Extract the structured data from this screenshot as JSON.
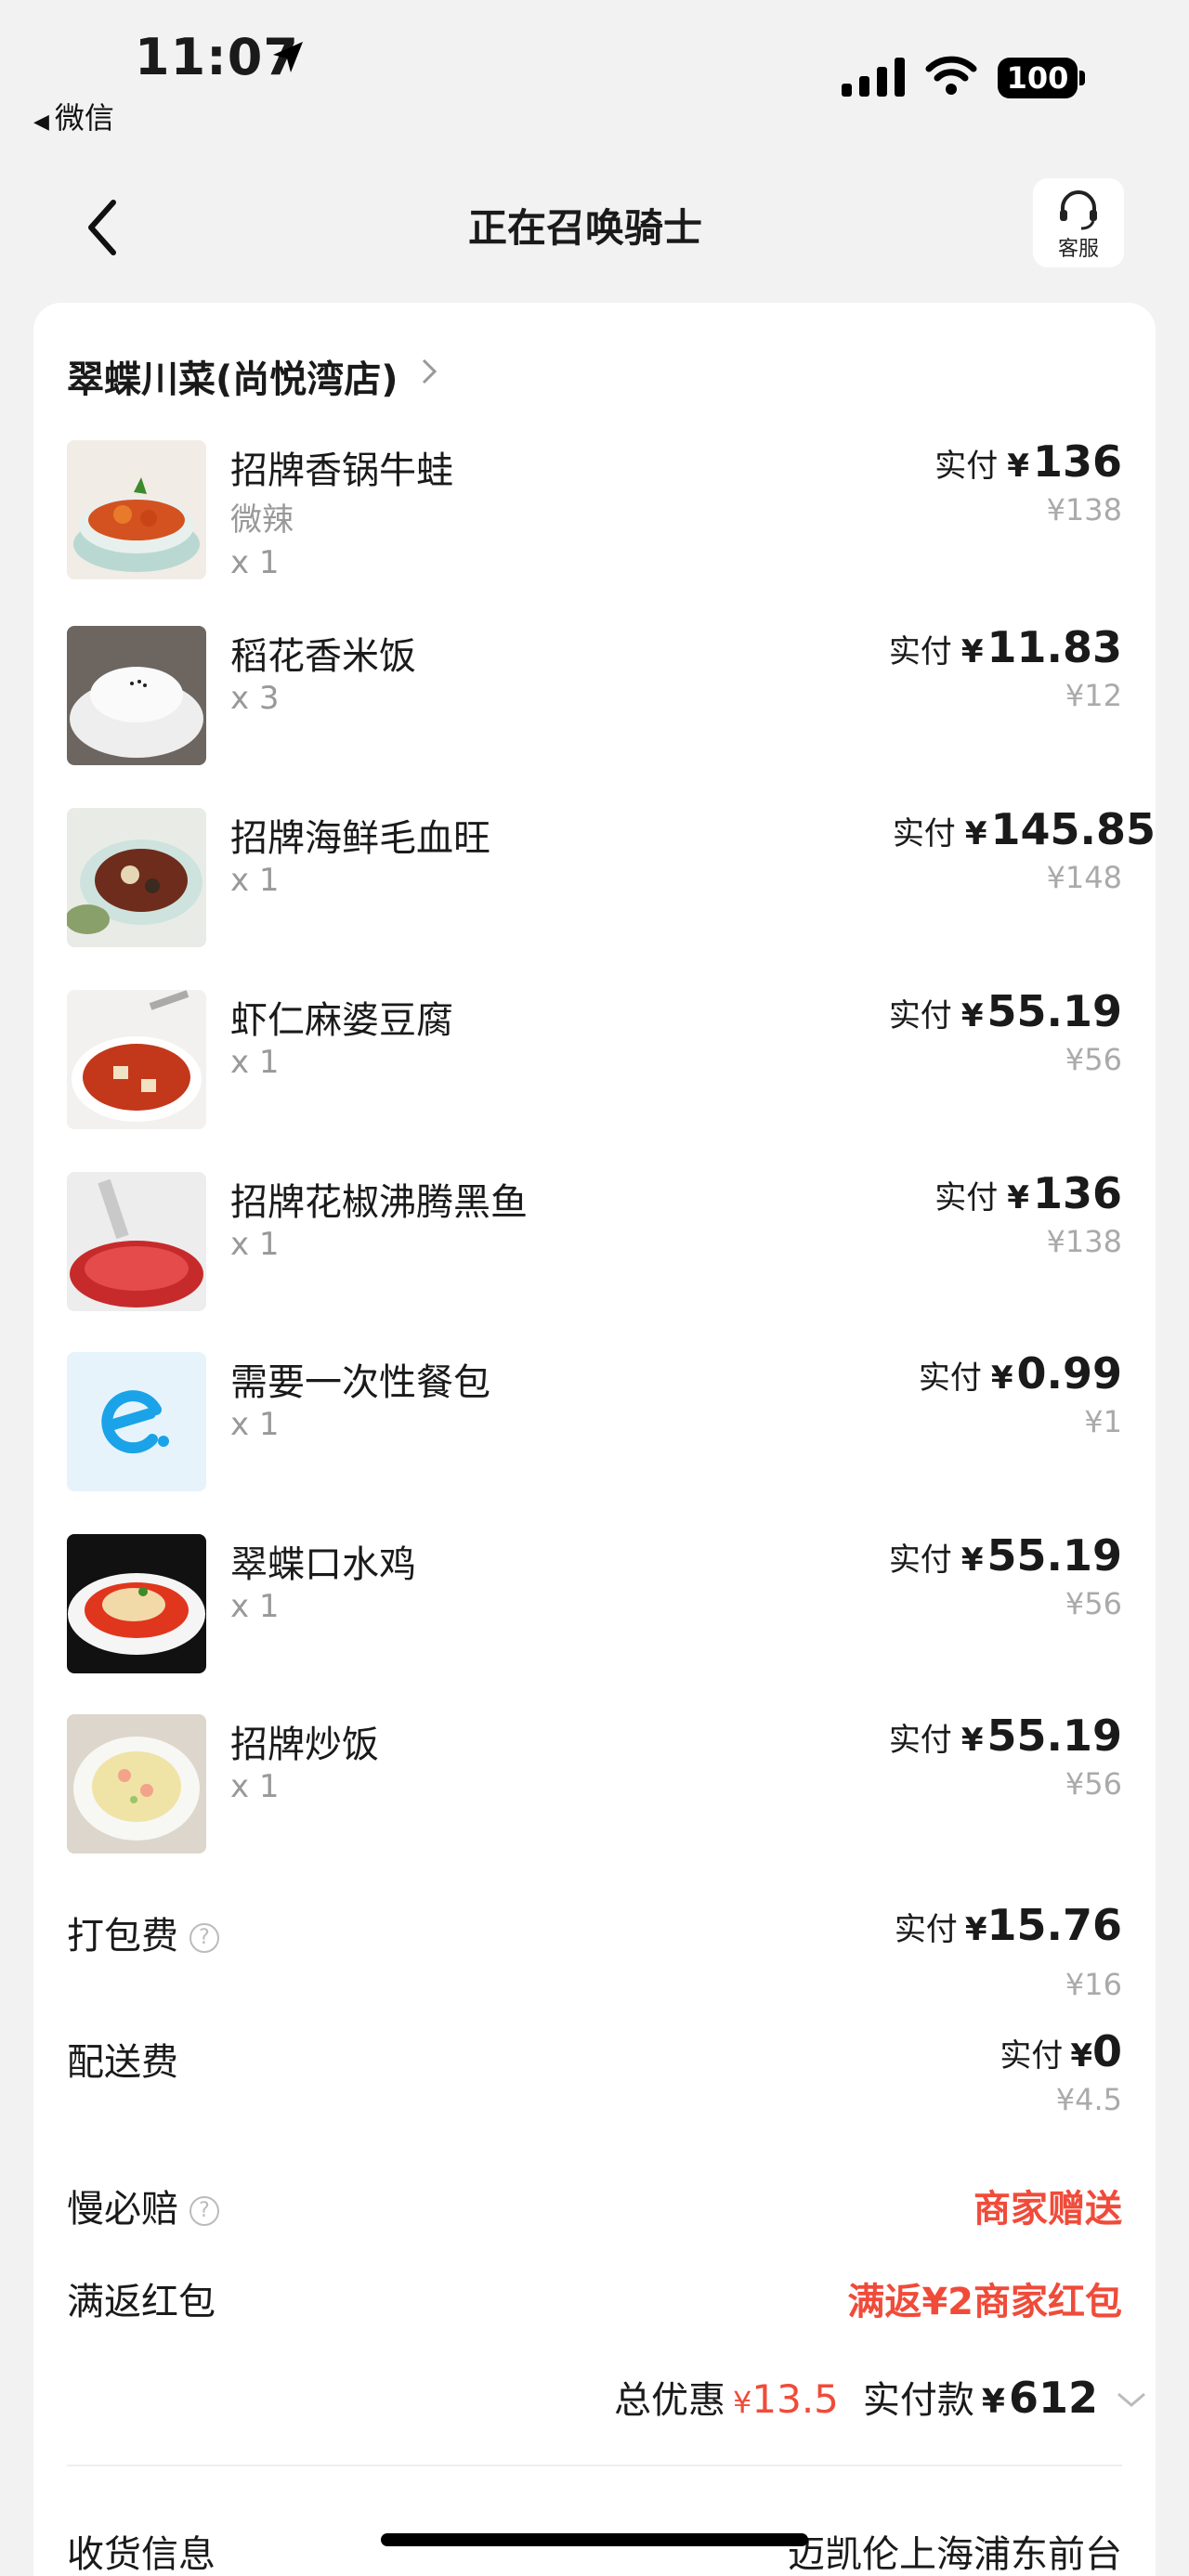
{
  "status_bar": {
    "time": "11:07",
    "back_app": "微信",
    "battery": "100"
  },
  "nav": {
    "title": "正在召唤骑士",
    "service_label": "客服"
  },
  "shop": {
    "name": "翠蝶川菜(尚悦湾店)"
  },
  "items": [
    {
      "name": "招牌香锅牛蛙",
      "spec": "微辣",
      "qty": "x 1",
      "paid_label": "实付",
      "currency": "¥",
      "paid": "136",
      "original": "¥138"
    },
    {
      "name": "稻花香米饭",
      "spec": "",
      "qty": "x 3",
      "paid_label": "实付",
      "currency": "¥",
      "paid": "11.83",
      "original": "¥12"
    },
    {
      "name": "招牌海鲜毛血旺",
      "spec": "",
      "qty": "x 1",
      "paid_label": "实付",
      "currency": "¥",
      "paid": "145.85",
      "original": "¥148"
    },
    {
      "name": "虾仁麻婆豆腐",
      "spec": "",
      "qty": "x 1",
      "paid_label": "实付",
      "currency": "¥",
      "paid": "55.19",
      "original": "¥56"
    },
    {
      "name": "招牌花椒沸腾黑鱼",
      "spec": "",
      "qty": "x 1",
      "paid_label": "实付",
      "currency": "¥",
      "paid": "136",
      "original": "¥138"
    },
    {
      "name": "需要一次性餐包",
      "spec": "",
      "qty": "x 1",
      "paid_label": "实付",
      "currency": "¥",
      "paid": "0.99",
      "original": "¥1"
    },
    {
      "name": "翠蝶口水鸡",
      "spec": "",
      "qty": "x 1",
      "paid_label": "实付",
      "currency": "¥",
      "paid": "55.19",
      "original": "¥56"
    },
    {
      "name": "招牌炒饭",
      "spec": "",
      "qty": "x 1",
      "paid_label": "实付",
      "currency": "¥",
      "paid": "55.19",
      "original": "¥56"
    }
  ],
  "fees": {
    "packing": {
      "label": "打包费",
      "paid_label": "实付",
      "currency": "¥",
      "paid": "15.76",
      "original": "¥16"
    },
    "delivery": {
      "label": "配送费",
      "paid_label": "实付",
      "currency": "¥",
      "paid": "0",
      "original": "¥4.5"
    },
    "slow": {
      "label": "慢必赔",
      "value": "商家赠送"
    },
    "redpacket": {
      "label": "满返红包",
      "value": "满返¥2商家红包"
    }
  },
  "summary": {
    "discount_label": "总优惠",
    "discount_currency": "¥",
    "discount": "13.5",
    "paid_label": "实付款",
    "paid_currency": "¥",
    "paid": "612"
  },
  "receiver": {
    "label": "收货信息",
    "value": "迈凯伦上海浦东前台"
  },
  "colors": {
    "accent_red": "#f04b3a",
    "muted": "#999999"
  }
}
